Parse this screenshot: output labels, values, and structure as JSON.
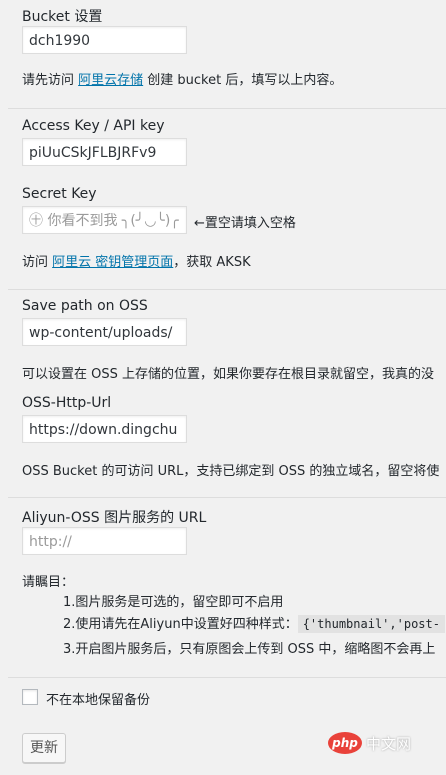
{
  "bucket": {
    "label": "Bucket 设置",
    "value": "dch1990",
    "desc_prefix": "请先访问 ",
    "link": "阿里云存储",
    "desc_suffix": " 创建 bucket 后，填写以上内容。"
  },
  "access_key": {
    "label": "Access Key / API key",
    "value": "piUuCSkJFLBJRFv9"
  },
  "secret_key": {
    "label": "Secret Key",
    "placeholder": "㊉ 你看不到我 ╮(╯◡╰)╭",
    "hint": "←置空请填入空格",
    "desc_prefix": "访问 ",
    "link": "阿里云 密钥管理页面",
    "desc_suffix": "，获取 AKSK"
  },
  "save_path": {
    "label": "Save path on OSS",
    "value": "wp-content/uploads/",
    "desc": "可以设置在 OSS 上存储的位置，如果你要存在根目录就留空，我真的没"
  },
  "http_url": {
    "label": "OSS-Http-Url",
    "value": "https://down.dingchu",
    "desc": "OSS Bucket 的可访问 URL，支持已绑定到 OSS 的独立域名，留空将使"
  },
  "img_service": {
    "label": "Aliyun-OSS 图片服务的 URL",
    "placeholder": "http://",
    "notes_title": "请瞩目：",
    "note1": "1.图片服务是可选的，留空即可不启用",
    "note2_prefix": "2.使用请先在Aliyun中设置好四种样式：",
    "note2_code": "{'thumbnail','post-",
    "note3": "3.开启图片服务后，只有原图会上传到 OSS 中，缩略图不会再上"
  },
  "local_backup": {
    "label": "不在本地保留备份",
    "checked": false
  },
  "submit": {
    "label": "更新"
  },
  "watermark": {
    "logo": "php",
    "text": "中文网"
  }
}
